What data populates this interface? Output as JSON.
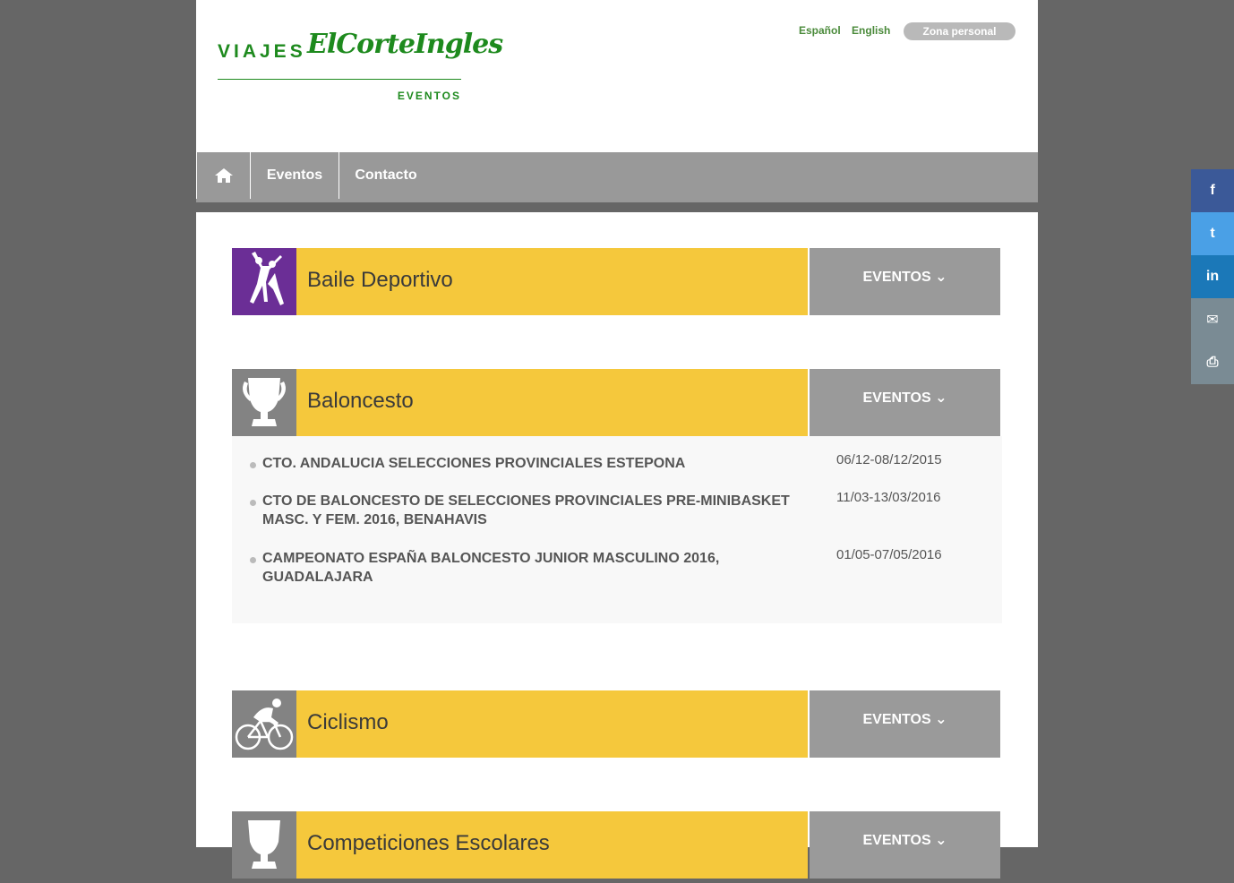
{
  "header": {
    "logo_viajes": "VIAJES",
    "logo_brand": "ElCorteIngles",
    "logo_sub": "EVENTOS",
    "languages": [
      "Español",
      "English"
    ],
    "zona_personal": "Zona personal"
  },
  "nav": {
    "eventos": "Eventos",
    "contacto": "Contacto"
  },
  "categories": [
    {
      "name": "Baile Deportivo",
      "button": "EVENTOS",
      "icon_color": "#6b2e96"
    },
    {
      "name": "Baloncesto",
      "button": "EVENTOS",
      "icon_color": "#838383"
    },
    {
      "name": "Ciclismo",
      "button": "EVENTOS",
      "icon_color": "#838383"
    },
    {
      "name": "Competiciones Escolares",
      "button": "EVENTOS",
      "icon_color": "#838383"
    }
  ],
  "events": [
    {
      "title": "CTO. ANDALUCIA SELECCIONES PROVINCIALES ESTEPONA",
      "dates": "06/12-08/12/2015"
    },
    {
      "title": "CTO DE BALONCESTO DE SELECCIONES PROVINCIALES PRE-MINIBASKET MASC. Y FEM. 2016, BENAHAVIS",
      "dates": "11/03-13/03/2016"
    },
    {
      "title": "CAMPEONATO ESPAÑA BALONCESTO JUNIOR MASCULINO 2016, GUADALAJARA",
      "dates": "01/05-07/05/2016"
    }
  ],
  "social": [
    {
      "name": "facebook",
      "label": "f",
      "color": "#3b5998"
    },
    {
      "name": "twitter",
      "label": "t",
      "color": "#4aa0e6"
    },
    {
      "name": "linkedin",
      "label": "in",
      "color": "#1b78b8"
    },
    {
      "name": "email",
      "label": "✉",
      "color": "#7a8b94"
    },
    {
      "name": "print",
      "label": "⎙",
      "color": "#7a8b94"
    }
  ]
}
